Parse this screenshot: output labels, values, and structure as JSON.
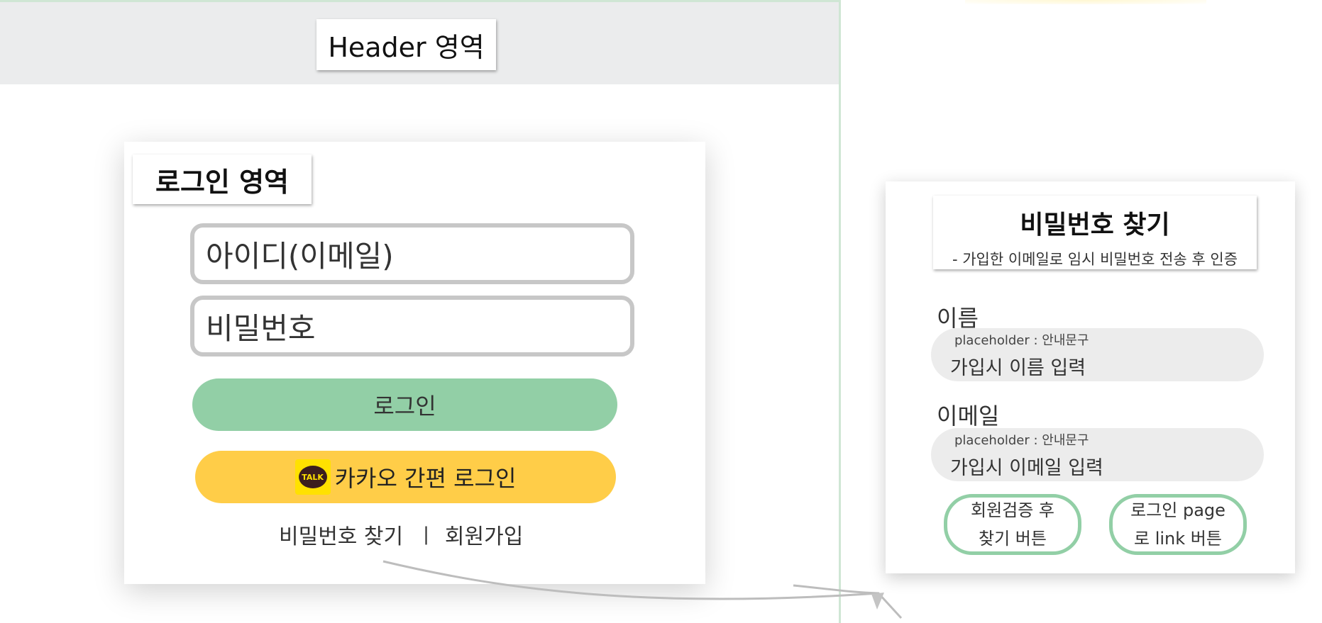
{
  "header": {
    "label": "Header 영역"
  },
  "login": {
    "area_label": "로그인 영역",
    "id_placeholder": "아이디(이메일)",
    "password_placeholder": "비밀번호",
    "login_button": "로그인",
    "kakao_button": "카카오 간편 로그인",
    "kakao_icon_text": "TALK",
    "find_password_link": "비밀번호 찾기",
    "separator": "|",
    "signup_link": "회원가입"
  },
  "find_password": {
    "title": "비밀번호 찾기",
    "subtitle": "- 가입한 이메일로 임시 비밀번호 전송 후 인증",
    "name_label": "이름",
    "name_placeholder_note": "placeholder : 안내문구",
    "name_placeholder": "가입시 이름 입력",
    "email_label": "이메일",
    "email_placeholder_note": "placeholder : 안내문구",
    "email_placeholder": "가입시 이메일 입력",
    "verify_button_line1": "회원검증 후",
    "verify_button_line2": "찾기 버튼",
    "login_link_button_line1": "로그인 page",
    "login_link_button_line2": "로 link 버튼"
  },
  "colors": {
    "header_band": "#ebeced",
    "login_button": "#92cfa6",
    "kakao_button": "#ffcd48",
    "input_border": "#c7c7c7",
    "grey_input": "#ececec",
    "frame_line": "#cfe6d4"
  }
}
